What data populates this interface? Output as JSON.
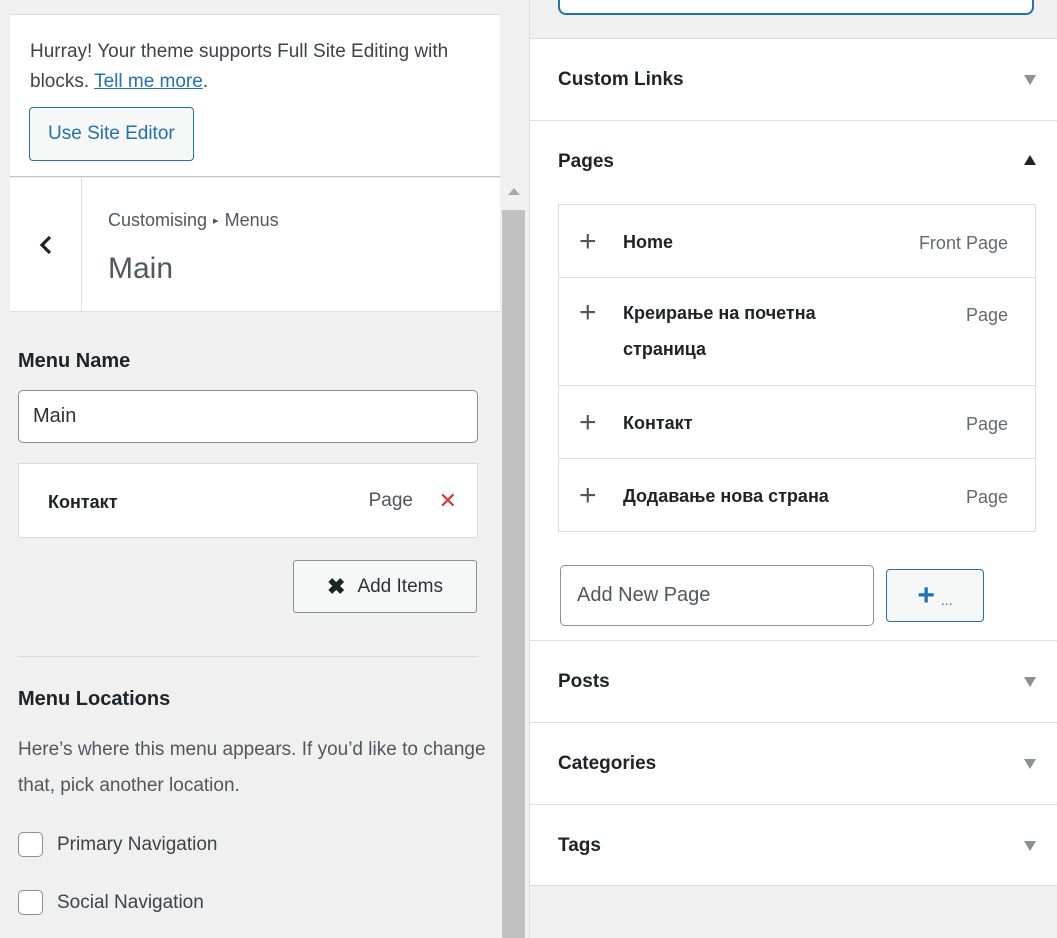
{
  "notice": {
    "text": "Hurray! Your theme supports Full Site Editing with blocks.",
    "link": "Tell me more",
    "period": ".",
    "button": "Use Site Editor"
  },
  "section": {
    "breadcrumb_parent": "Customising",
    "breadcrumb_separator": "▸",
    "breadcrumb_current": "Menus",
    "title": "Main"
  },
  "menu_name": {
    "label": "Menu Name",
    "value": "Main"
  },
  "menu_items": [
    {
      "title": "Контакт",
      "type": "Page"
    }
  ],
  "add_items_button": "Add Items",
  "menu_locations": {
    "title": "Menu Locations",
    "description": "Here’s where this menu appears. If you’d like to change that, pick another location.",
    "options": [
      {
        "label": "Primary Navigation",
        "checked": false
      },
      {
        "label": "Social Navigation",
        "checked": false
      }
    ]
  },
  "panels": {
    "custom_links": "Custom Links",
    "pages": "Pages",
    "posts": "Posts",
    "categories": "Categories",
    "tags": "Tags"
  },
  "pages": [
    {
      "title": "Home",
      "type": "Front Page"
    },
    {
      "title": "Креирање на почетна страница",
      "type": "Page"
    },
    {
      "title": "Контакт",
      "type": "Page"
    },
    {
      "title": "Додавање нова страна",
      "type": "Page"
    }
  ],
  "add_new_page": {
    "placeholder": "Add New Page",
    "button_ellipsis": "..."
  },
  "colors": {
    "accent": "#2271b1",
    "danger": "#d63638",
    "panel_bg": "#f0f0f1"
  },
  "icons": {
    "back": "chevron-left-icon",
    "remove": "close-icon",
    "add": "plus-icon",
    "expand": "caret-down-icon",
    "collapse": "caret-up-icon"
  }
}
